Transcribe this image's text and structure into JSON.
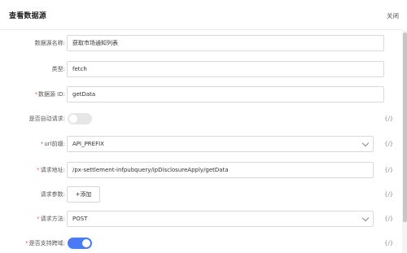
{
  "dialog": {
    "title": "查看数据源",
    "close_label": "关闭"
  },
  "form": {
    "name_label": "数据源名称:",
    "name_value": "获取市场通知列表",
    "type_label": "类型:",
    "type_value": "fetch",
    "id_label": "数据源 ID:",
    "id_value": "getData",
    "auto_request_label": "是否自动请求:",
    "auto_request_on": false,
    "url_prefix_label": "url前缀:",
    "url_prefix_value": "API_PREFIX",
    "request_url_label": "请求地址:",
    "request_url_value": "/px-settlement-infpubquery/ipDisclosureApply/getData",
    "request_params_label": "请求参数:",
    "add_button_label": "+添加",
    "request_method_label": "请求方法:",
    "request_method_value": "POST",
    "cors_label": "是否支持跨域:",
    "cors_on": true,
    "fx_symbol": "{/}"
  },
  "colors": {
    "accent": "#4a7bf7",
    "required": "#f25c5c"
  }
}
